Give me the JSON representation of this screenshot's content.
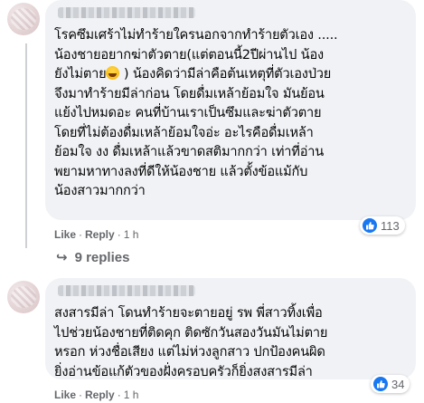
{
  "comments": [
    {
      "text_a": "โรคซึมเศร้าไม่ทำร้ายใครนอกจากทำร้ายตัวเอง .....\nน้องชายอยากฆ่าตัวตาย(แต่ตอนนี้2ปีผ่านไป น้อง\nยังไม่ตาย",
      "text_b": " ) น้องคิดว่ามีล่าคือต้นเหตุที่ตัวเองป่วย\nจึงมาทำร้ายมีล่าก่อน โดยดื่มเหล้าย้อมใจ มันย้อน\nแย้งไปหมดอะ คนที่บ้านเราเป็นซึมและฆ่าตัวตาย\nโดยที่ไม่ต้องดื่มเหล้าย้อมใจอ่ะ อะไรคือดื่มเหล้า\nย้อมใจ งง ดื่มเหล้าแล้วขาดสติมากกว่า เท่าที่อ่าน\nพยามหาทางลงที่ดีให้น้องชาย แล้วตั้งข้อแม้กับ\nน้องสาวมากกว่า",
      "emoji": "laughing-emoji",
      "reaction_count": "113",
      "like_label": "Like",
      "reply_label": "Reply",
      "time": "1 h",
      "replies_label": "9 replies"
    },
    {
      "text": "สงสารมีล่า โดนทำร้ายจะตายอยู่ รพ พี่สาวทิ้งเพื่อ\nไปช่วยน้องชายที่ติดคุก ติดซักวันสองวันมันไม่ตาย\nหรอก ห่วงชื่อเสียง แต่ไม่ห่วงลูกสาว ปกป้องคนผิด\nยิ่งอ่านข้อแก้ตัวของฝั่งครอบครัวก็ยิ่งสงสารมีล่า",
      "reaction_count": "34",
      "like_label": "Like",
      "reply_label": "Reply",
      "time": "1 h"
    }
  ],
  "colors": {
    "bubble": "#f0f2f5",
    "meta": "#65676b",
    "like_blue": "#1877f2"
  }
}
